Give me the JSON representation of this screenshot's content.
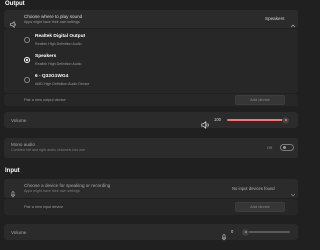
{
  "output": {
    "title": "Output",
    "choose_title": "Choose where to play sound",
    "choose_subtitle": "Apps might have their own settings",
    "selected_device": "Speakers",
    "devices": [
      {
        "name": "Realtek Digital Output",
        "driver": "Realtek High Definition Audio"
      },
      {
        "name": "Speakers",
        "driver": "Realtek High Definition Audio"
      },
      {
        "name": "6 - Q32G1WG4",
        "driver": "AMD High Definition Audio Device"
      }
    ],
    "pair_label": "Pair a new output device",
    "add_button": "Add device",
    "volume_label": "Volume",
    "volume_value": "100",
    "volume_fraction": 1.0,
    "mono_title": "Mono audio",
    "mono_subtitle": "Combine left and right audio channels into one",
    "mono_state": "Off"
  },
  "input": {
    "title": "Input",
    "choose_title": "Choose a device for speaking or recording",
    "choose_subtitle": "Apps might have their own settings",
    "selected_device": "No input devices found",
    "pair_label": "Pair a new input device",
    "add_button": "Add device",
    "volume_label": "Volume",
    "volume_value": "0",
    "volume_fraction": 0.0
  },
  "colors": {
    "accent": "#ff6f79",
    "bg": "#202020",
    "card": "#2b2b2b"
  }
}
